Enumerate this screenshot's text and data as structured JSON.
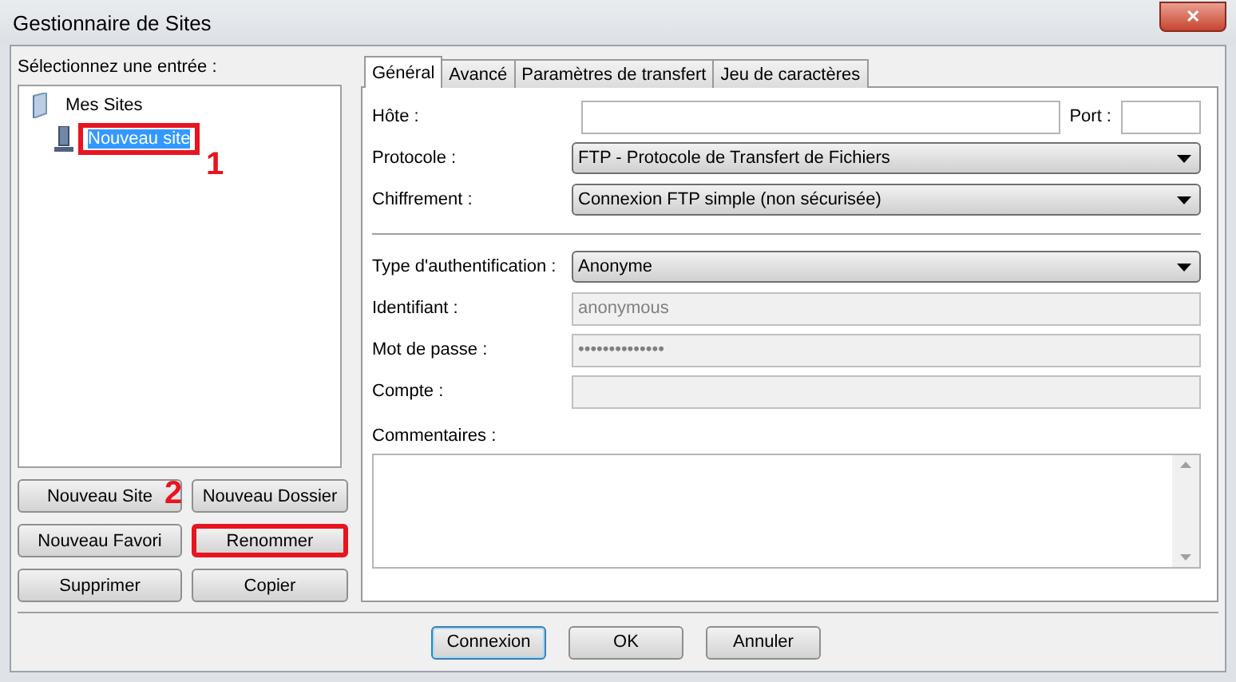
{
  "window": {
    "title": "Gestionnaire de Sites",
    "close": "✕"
  },
  "site_tree": {
    "label": "Sélectionnez une entrée :",
    "items": [
      {
        "label": "Mes Sites",
        "selected": false,
        "highlighted": false,
        "kind": "folder",
        "children": [
          {
            "label": "Nouveau site",
            "selected": true,
            "highlighted": true,
            "kind": "site"
          }
        ]
      }
    ]
  },
  "site_buttons": [
    {
      "label": "Nouveau Site",
      "highlighted": false
    },
    {
      "label": "Nouveau Dossier",
      "highlighted": false
    },
    {
      "label": "Nouveau Favori",
      "highlighted": false
    },
    {
      "label": "Renommer",
      "highlighted": true
    },
    {
      "label": "Supprimer",
      "highlighted": false
    },
    {
      "label": "Copier",
      "highlighted": false
    }
  ],
  "markers": [
    {
      "text": "1"
    },
    {
      "text": "2"
    }
  ],
  "tabs": [
    {
      "label": "Général",
      "selected": true
    },
    {
      "label": "Avancé",
      "selected": false
    },
    {
      "label": "Paramètres de transfert",
      "selected": false
    },
    {
      "label": "Jeu de caractères",
      "selected": false
    }
  ],
  "host": {
    "label": "Hôte :",
    "port_label": "Port :"
  },
  "fields": [
    {
      "kind": "select",
      "label": "Protocole :",
      "value": "FTP - Protocole de Transfert de Fichiers",
      "disabled": false
    },
    {
      "kind": "select",
      "label": "Chiffrement :",
      "value": "Connexion FTP simple (non sécurisée)",
      "disabled": false
    },
    {
      "kind": "separator"
    },
    {
      "kind": "select",
      "label": "Type d'authentification :",
      "value": "Anonyme",
      "disabled": false
    },
    {
      "kind": "text",
      "label": "Identifiant :",
      "value": "anonymous",
      "disabled": true
    },
    {
      "kind": "password",
      "label": "Mot de passe :",
      "value": "••••••••••••••",
      "disabled": true
    },
    {
      "kind": "text",
      "label": "Compte :",
      "disabled": true
    }
  ],
  "comments": {
    "label": "Commentaires :"
  },
  "dialog_buttons": [
    {
      "label": "Connexion",
      "default": true
    },
    {
      "label": "OK",
      "default": false
    },
    {
      "label": "Annuler",
      "default": false
    }
  ]
}
